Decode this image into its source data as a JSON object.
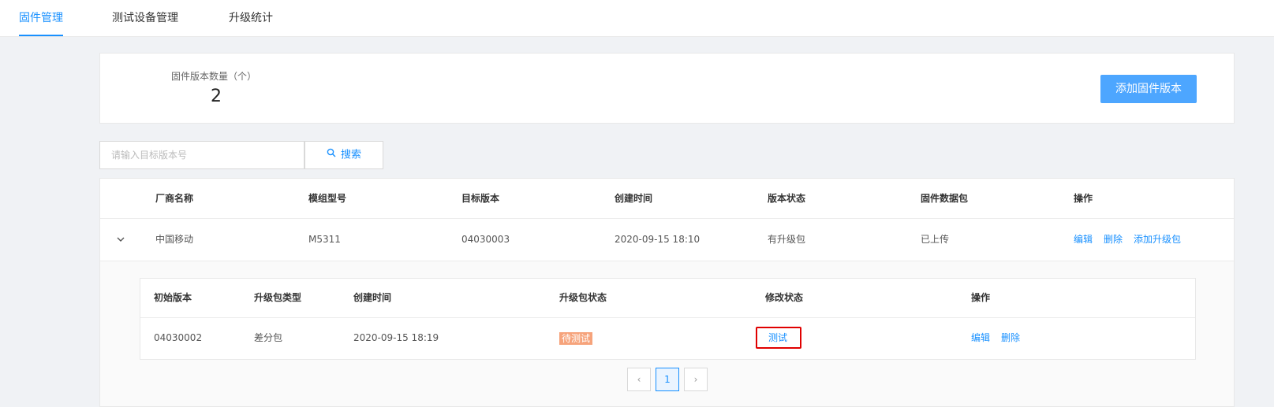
{
  "nav": {
    "tabs": [
      {
        "label": "固件管理",
        "active": true
      },
      {
        "label": "测试设备管理",
        "active": false
      },
      {
        "label": "升级统计",
        "active": false
      }
    ]
  },
  "stats": {
    "label": "固件版本数量（个）",
    "value": "2",
    "add_button": "添加固件版本"
  },
  "search": {
    "placeholder": "请输入目标版本号",
    "button": "搜索"
  },
  "table": {
    "headers": [
      "厂商名称",
      "模组型号",
      "目标版本",
      "创建时间",
      "版本状态",
      "固件数据包",
      "操作"
    ],
    "rows": [
      {
        "vendor": "中国移动",
        "model": "M5311",
        "target_version": "04030003",
        "created": "2020-09-15 18:10",
        "version_status": "有升级包",
        "package": "已上传",
        "actions": [
          "编辑",
          "删除",
          "添加升级包"
        ]
      }
    ]
  },
  "sub_table": {
    "headers": [
      "初始版本",
      "升级包类型",
      "创建时间",
      "升级包状态",
      "修改状态",
      "操作"
    ],
    "rows": [
      {
        "initial_version": "04030002",
        "package_type": "差分包",
        "created": "2020-09-15 18:19",
        "package_status": "待测试",
        "modify_status": "测试",
        "actions": [
          "编辑",
          "删除"
        ]
      }
    ]
  },
  "pagination": {
    "prev": "‹",
    "current": "1",
    "next": "›"
  },
  "colors": {
    "accent": "#1890ff",
    "primary_button": "#4da6ff",
    "badge": "#f6a37b",
    "highlight": "#e00000"
  }
}
